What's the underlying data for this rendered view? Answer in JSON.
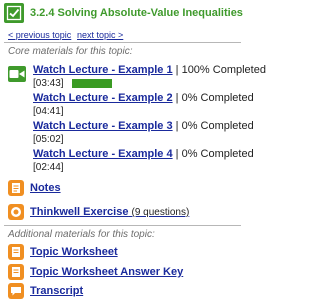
{
  "header": {
    "title": "3.2.4 Solving Absolute-Value Inequalities",
    "check_icon": "check-icon"
  },
  "nav": {
    "previous": "< previous topic",
    "next": "next topic >"
  },
  "core": {
    "label": "Core materials for this topic:",
    "lectures": [
      {
        "title": "Watch Lecture - Example 1",
        "status": "| 100% Completed",
        "duration": "[03:43]",
        "progress": 1.0
      },
      {
        "title": "Watch Lecture - Example 2",
        "status": "| 0% Completed",
        "duration": "[04:41]"
      },
      {
        "title": "Watch Lecture - Example 3",
        "status": "| 0% Completed",
        "duration": "[05:02]"
      },
      {
        "title": "Watch Lecture - Example 4",
        "status": "| 0% Completed",
        "duration": "[02:44]"
      }
    ],
    "notes": {
      "label": "Notes",
      "icon": "notes-icon"
    },
    "exercise": {
      "label": "Thinkwell Exercise",
      "meta": "(9 questions)",
      "icon": "exercise-icon"
    }
  },
  "additional": {
    "label": "Additional materials for this topic:",
    "items": [
      {
        "label": "Topic Worksheet",
        "icon": "worksheet-icon"
      },
      {
        "label": "Topic Worksheet Answer Key",
        "icon": "answer-key-icon"
      },
      {
        "label": "Transcript",
        "icon": "transcript-icon"
      }
    ]
  },
  "colors": {
    "green": "#3f9a2c",
    "orange": "#f08f22",
    "link": "#1a2a9c",
    "section_label": "#6d6d6d"
  }
}
